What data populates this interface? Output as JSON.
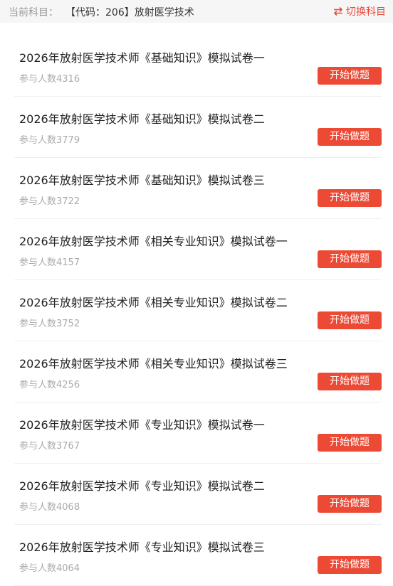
{
  "header": {
    "subject_label": "当前科目：",
    "subject_name": "【代码：206】放射医学技术",
    "switch_label": "切换科目",
    "switch_icon": "swap-arrows-icon"
  },
  "colors": {
    "accent": "#ec4a35",
    "muted": "#aaaaaa"
  },
  "items": [
    {
      "title": "2026年放射医学技术师《基础知识》模拟试卷一",
      "count": "参与人数4316",
      "button": "开始做题"
    },
    {
      "title": "2026年放射医学技术师《基础知识》模拟试卷二",
      "count": "参与人数3779",
      "button": "开始做题"
    },
    {
      "title": "2026年放射医学技术师《基础知识》模拟试卷三",
      "count": "参与人数3722",
      "button": "开始做题"
    },
    {
      "title": "2026年放射医学技术师《相关专业知识》模拟试卷一",
      "count": "参与人数4157",
      "button": "开始做题"
    },
    {
      "title": "2026年放射医学技术师《相关专业知识》模拟试卷二",
      "count": "参与人数3752",
      "button": "开始做题"
    },
    {
      "title": "2026年放射医学技术师《相关专业知识》模拟试卷三",
      "count": "参与人数4256",
      "button": "开始做题"
    },
    {
      "title": "2026年放射医学技术师《专业知识》模拟试卷一",
      "count": "参与人数3767",
      "button": "开始做题"
    },
    {
      "title": "2026年放射医学技术师《专业知识》模拟试卷二",
      "count": "参与人数4068",
      "button": "开始做题"
    },
    {
      "title": "2026年放射医学技术师《专业知识》模拟试卷三",
      "count": "参与人数4064",
      "button": "开始做题"
    }
  ]
}
